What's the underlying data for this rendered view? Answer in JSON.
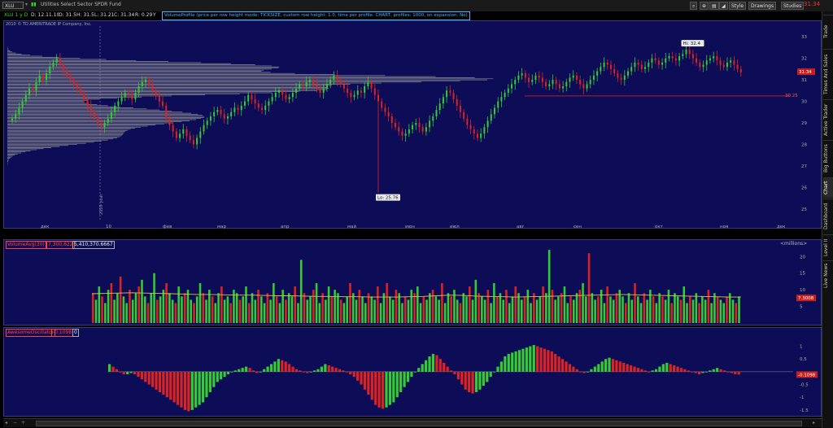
{
  "window": {
    "symbol": "XLU",
    "symbol_desc": "Utilities Select Sector SPDR Fund",
    "last_price": "31.34",
    "buttons": {
      "style": "Style",
      "drawings": "Drawings",
      "studies": "Studies"
    }
  },
  "infobar": {
    "ticker": "XLU 1 y D",
    "date": "D: 12.11.10",
    "open": "O: 31.5",
    "high": "H: 31.5",
    "low": "L: 31.21",
    "close": "C: 31.34",
    "range": "R: 0.29",
    "flag": "Y",
    "study": "VolumeProfile (price per row height mode: TICKSIZE, custom row height: 1.0, time per profile: CHART, profiles: 1000, on expansion: No)"
  },
  "copyright": "2010 © TD AMERITRADE IP Company, Inc.",
  "sidebar": {
    "tabs": [
      "Trade",
      "Times And Sales",
      "Active Trader",
      "Big Buttons",
      "Chart",
      "Dashboard",
      "Level II",
      "Live News"
    ]
  },
  "colors": {
    "background": "#0d0d57",
    "up": "#33cc33",
    "down": "#dd2222",
    "profile": "#9a9a9a",
    "ma": "#d6c24a",
    "hline": "#cc2222"
  },
  "chart_data": [
    {
      "type": "candlestick",
      "x_ticks": [
        "дек",
        "10",
        "фев",
        "мар",
        "апр",
        "май",
        "июн",
        "июл",
        "авг",
        "сен",
        "окт",
        "ноя",
        "дек"
      ],
      "ylim": [
        24.5,
        33.5
      ],
      "y_ticks": [
        25,
        26,
        27,
        28,
        29,
        30,
        31,
        32,
        33
      ],
      "annotations": {
        "high_label": "Hi: 32.4",
        "low_label": "Lo: 25.76",
        "hline_label": "30.25",
        "year_label": "2009 year",
        "last_label": "31.34"
      },
      "hline": 30.25,
      "closes": [
        29.2,
        29.4,
        29.7,
        30.0,
        30.3,
        30.6,
        30.5,
        30.9,
        31.2,
        31.0,
        31.3,
        31.6,
        31.8,
        32.0,
        31.7,
        31.4,
        31.2,
        31.0,
        30.8,
        30.6,
        30.4,
        30.1,
        29.8,
        29.5,
        29.2,
        29.0,
        28.8,
        29.0,
        29.2,
        29.5,
        29.8,
        30.0,
        30.2,
        30.4,
        30.3,
        30.1,
        30.4,
        30.7,
        30.9,
        31.0,
        30.8,
        30.5,
        30.3,
        30.0,
        29.8,
        29.2,
        28.9,
        28.6,
        28.3,
        28.5,
        28.7,
        28.4,
        28.2,
        28.0,
        28.3,
        28.6,
        28.9,
        29.1,
        29.3,
        29.5,
        29.6,
        29.4,
        29.2,
        29.3,
        29.5,
        29.7,
        29.6,
        29.8,
        30.0,
        30.3,
        30.1,
        29.9,
        29.7,
        29.6,
        29.8,
        30.0,
        30.2,
        30.4,
        30.5,
        30.3,
        30.1,
        30.2,
        30.4,
        30.6,
        30.8,
        30.7,
        30.9,
        31.0,
        30.8,
        30.6,
        30.4,
        30.6,
        30.8,
        31.0,
        31.2,
        31.0,
        30.8,
        30.6,
        30.4,
        30.2,
        30.3,
        30.5,
        30.4,
        30.7,
        30.9,
        30.6,
        30.3,
        30.0,
        29.7,
        29.5,
        29.3,
        29.0,
        28.8,
        28.6,
        28.4,
        28.5,
        28.7,
        28.9,
        29.0,
        28.8,
        28.6,
        28.8,
        29.1,
        29.3,
        29.6,
        29.9,
        30.2,
        30.5,
        30.4,
        30.1,
        29.8,
        29.5,
        29.2,
        28.9,
        28.7,
        28.5,
        28.3,
        28.5,
        28.8,
        29.1,
        29.4,
        29.7,
        30.0,
        30.2,
        30.4,
        30.6,
        30.8,
        31.0,
        31.2,
        31.3,
        31.1,
        30.9,
        31.0,
        31.2,
        31.1,
        30.9,
        30.7,
        30.8,
        31.0,
        30.8,
        30.6,
        30.7,
        30.9,
        31.1,
        31.2,
        31.0,
        30.8,
        30.6,
        30.8,
        31.0,
        31.2,
        31.4,
        31.6,
        31.8,
        31.7,
        31.5,
        31.3,
        31.1,
        31.0,
        31.2,
        31.4,
        31.6,
        31.8,
        31.7,
        31.5,
        31.6,
        31.8,
        32.0,
        31.9,
        31.7,
        31.8,
        32.0,
        32.1,
        32.0,
        31.9,
        32.1,
        32.2,
        32.4,
        32.2,
        32.0,
        31.8,
        31.6,
        31.7,
        31.9,
        32.0,
        32.1,
        31.9,
        31.7,
        31.6,
        31.8,
        31.9,
        31.7,
        31.5,
        31.34
      ]
    },
    {
      "type": "bar",
      "title": "VolumeAvg(30)",
      "values_label": "7,300,622",
      "avg_label": "5,410,370.6667",
      "unit_label": "<millions>",
      "last_label": "7.3008",
      "ylim": [
        0,
        23
      ],
      "y_ticks": [
        5,
        10,
        15,
        20
      ],
      "values": [
        9,
        7,
        11,
        8,
        6,
        10,
        12,
        7,
        9,
        14,
        8,
        6,
        10,
        7,
        9,
        11,
        13,
        8,
        6,
        9,
        15,
        7,
        8,
        10,
        12,
        9,
        7,
        6,
        11,
        8,
        9,
        10,
        7,
        6,
        8,
        12,
        9,
        7,
        10,
        8,
        6,
        9,
        11,
        7,
        8,
        6,
        10,
        9,
        7,
        8,
        11,
        6,
        9,
        7,
        10,
        8,
        6,
        9,
        7,
        12,
        8,
        6,
        10,
        7,
        9,
        8,
        11,
        6,
        19,
        9,
        7,
        8,
        10,
        12,
        6,
        9,
        7,
        11,
        8,
        10,
        9,
        7,
        6,
        8,
        12,
        9,
        7,
        10,
        8,
        6,
        9,
        8,
        7,
        11,
        6,
        9,
        12,
        8,
        7,
        10,
        9,
        6,
        8,
        7,
        10,
        9,
        11,
        6,
        8,
        7,
        9,
        10,
        8,
        7,
        12,
        6,
        9,
        8,
        10,
        7,
        6,
        9,
        8,
        11,
        7,
        13,
        9,
        8,
        7,
        10,
        6,
        12,
        8,
        9,
        7,
        10,
        6,
        8,
        11,
        9,
        7,
        8,
        10,
        6,
        9,
        7,
        8,
        11,
        9,
        22,
        10,
        7,
        8,
        9,
        11,
        6,
        8,
        7,
        9,
        10,
        12,
        8,
        21,
        9,
        7,
        8,
        10,
        6,
        11,
        8,
        7,
        9,
        10,
        8,
        6,
        9,
        7,
        12,
        8,
        6,
        9,
        7,
        10,
        8,
        6,
        9,
        8,
        7,
        10,
        6,
        9,
        8,
        7,
        11,
        6,
        8,
        7,
        9,
        6,
        8,
        7,
        10,
        6,
        9,
        8,
        7,
        6,
        8,
        9,
        7,
        6,
        8
      ],
      "ma": [
        8.8,
        8.9,
        9.0,
        9.1,
        9.0,
        8.9,
        8.8,
        8.7,
        8.6,
        8.6,
        8.5,
        8.4,
        8.4,
        8.3,
        8.2,
        8.2,
        8.1,
        8.0,
        8.0,
        7.9,
        7.9,
        7.8,
        7.8,
        7.8,
        7.9,
        8.0,
        8.2,
        8.4,
        8.3,
        8.1,
        8.0,
        7.9,
        7.8,
        7.9,
        8.0,
        8.1,
        8.2,
        8.3,
        8.4,
        8.5,
        8.6,
        8.5,
        8.4,
        8.3,
        8.2,
        8.1,
        8.0,
        7.9,
        7.8,
        7.8
      ]
    },
    {
      "type": "bar",
      "title": "AwesomeOscillator",
      "value_label": "-0.1098",
      "zero_label": "0",
      "last_label": "-0.1098",
      "ylim": [
        -1.6,
        1.4
      ],
      "y_ticks": [
        1,
        0.5,
        -0.5,
        -1,
        -1.5
      ],
      "values": [
        0.3,
        0.2,
        0.1,
        0.0,
        -0.1,
        -0.1,
        -0.05,
        -0.1,
        -0.2,
        -0.3,
        -0.4,
        -0.5,
        -0.6,
        -0.7,
        -0.8,
        -0.9,
        -1.0,
        -1.1,
        -1.2,
        -1.3,
        -1.4,
        -1.5,
        -1.55,
        -1.5,
        -1.4,
        -1.3,
        -1.2,
        -1.0,
        -0.8,
        -0.6,
        -0.4,
        -0.3,
        -0.2,
        -0.1,
        0.0,
        0.05,
        0.1,
        0.15,
        0.2,
        0.15,
        0.05,
        -0.05,
        0.0,
        0.1,
        0.2,
        0.3,
        0.4,
        0.5,
        0.45,
        0.4,
        0.3,
        0.2,
        0.1,
        0.05,
        0.0,
        -0.05,
        0.0,
        0.05,
        0.1,
        0.2,
        0.3,
        0.25,
        0.2,
        0.15,
        0.1,
        0.05,
        0.0,
        -0.1,
        -0.2,
        -0.35,
        -0.5,
        -0.7,
        -0.9,
        -1.1,
        -1.3,
        -1.4,
        -1.45,
        -1.4,
        -1.3,
        -1.2,
        -1.0,
        -0.8,
        -0.6,
        -0.4,
        -0.2,
        0.0,
        0.15,
        0.3,
        0.45,
        0.6,
        0.7,
        0.65,
        0.5,
        0.35,
        0.2,
        0.05,
        -0.1,
        -0.3,
        -0.5,
        -0.7,
        -0.8,
        -0.85,
        -0.8,
        -0.7,
        -0.55,
        -0.4,
        -0.2,
        0.0,
        0.2,
        0.4,
        0.6,
        0.7,
        0.75,
        0.8,
        0.85,
        0.9,
        0.95,
        1.0,
        1.05,
        1.0,
        0.95,
        0.9,
        0.85,
        0.8,
        0.7,
        0.6,
        0.5,
        0.4,
        0.3,
        0.2,
        0.1,
        0.0,
        -0.05,
        0.0,
        0.1,
        0.2,
        0.3,
        0.4,
        0.5,
        0.55,
        0.5,
        0.45,
        0.4,
        0.35,
        0.3,
        0.25,
        0.2,
        0.15,
        0.1,
        0.05,
        0.0,
        0.05,
        0.1,
        0.2,
        0.3,
        0.35,
        0.3,
        0.25,
        0.2,
        0.15,
        0.1,
        0.05,
        0.0,
        -0.05,
        -0.1,
        -0.05,
        0.0,
        0.05,
        0.1,
        0.15,
        0.1,
        0.05,
        0.0,
        -0.05,
        -0.1,
        -0.11
      ]
    }
  ]
}
